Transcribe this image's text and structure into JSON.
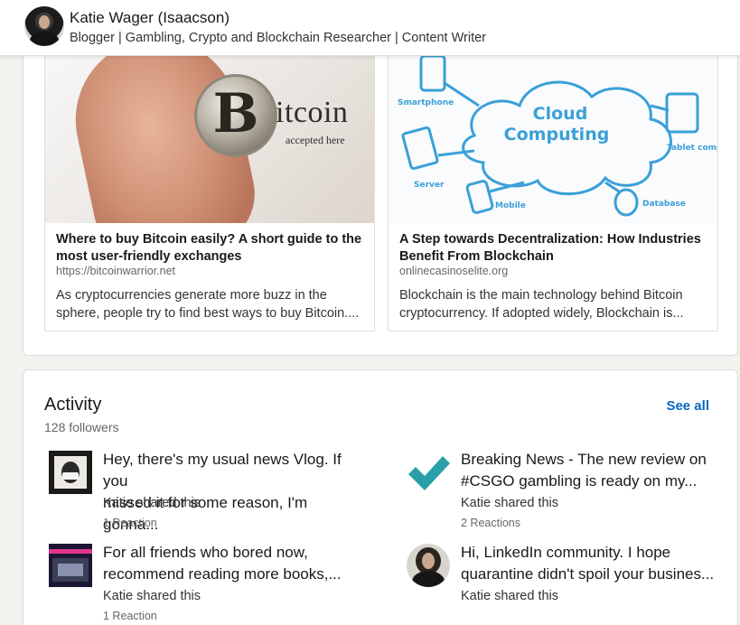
{
  "profile": {
    "name": "Katie Wager (Isaacson)",
    "headline": "Blogger | Gambling, Crypto and Blockchain Researcher | Content Writer"
  },
  "articles": [
    {
      "title": "Where to buy Bitcoin easily? A short guide to the most user-friendly exchanges",
      "url": "https://bitcoinwarrior.net",
      "description": "As cryptocurrencies generate more buzz in the sphere, people try to find best ways to buy Bitcoin....",
      "image": {
        "coin_letter": "B",
        "word": "itcoin",
        "subtext": "accepted here"
      }
    },
    {
      "title": "A Step towards Decentralization: How Industries Benefit From Blockchain",
      "url": "onlinecasinoselite.org",
      "description": "Blockchain is the main technology behind Bitcoin cryptocurrency. If adopted widely, Blockchain is...",
      "image": {
        "cloud_line1": "Cloud",
        "cloud_line2": "Computing",
        "labels": {
          "smartphone": "Smartphone",
          "tablet": "Tablet computer",
          "server": "Server",
          "mobile": "Mobile",
          "database": "Database"
        }
      }
    }
  ],
  "activity": {
    "title": "Activity",
    "followers": "128 followers",
    "see_all": "See all",
    "posts": [
      {
        "text_line1": "Hey, there's my usual news Vlog. If you",
        "text_line2": "missed it for some reason, I'm gonna...",
        "shared_by": "Katie shared this",
        "reactions": "1 Reaction",
        "thumb_icon": "vlog-thumbnail"
      },
      {
        "text_line1": "Breaking News - The new review on",
        "text_line2": "#CSGO gambling is ready on my...",
        "shared_by": "Katie shared this",
        "reactions": "2 Reactions",
        "thumb_icon": "checkmark-icon"
      },
      {
        "text_line1": "For all friends who bored now,",
        "text_line2": "recommend reading more books,...",
        "shared_by": "Katie shared this",
        "reactions": "1 Reaction",
        "thumb_icon": "books-thumbnail"
      },
      {
        "text_line1": "Hi, LinkedIn community. I hope",
        "text_line2": "quarantine didn't spoil your busines...",
        "shared_by": "Katie shared this",
        "reactions": "",
        "thumb_icon": "profile-photo"
      }
    ]
  },
  "colors": {
    "link_blue": "#0a66c2",
    "check_teal": "#2a9fa8",
    "page_bg": "#f3f2ef"
  }
}
